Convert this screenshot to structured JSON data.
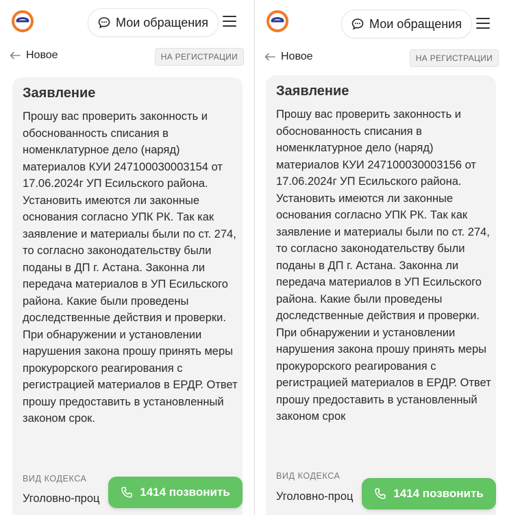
{
  "screens": [
    {
      "header": {
        "my_requests_label": "Мои обращения"
      },
      "subheader": {
        "back_label": "Новое",
        "status_badge": "НА РЕГИСТРАЦИИ"
      },
      "card": {
        "title": "Заявление",
        "body": "Прошу вас проверить законность и обоснованность списания в номенклатурное дело (наряд) материалов КУИ 247100030003154 от 17.06.2024г УП Есильского района. Установить имеются ли законные основания согласно УПК РК. Так как заявление и материалы были по ст. 274, то согласно законодательству были поданы в ДП г. Астана. Законна ли передача материалов в УП Есильского района. Какие были проведены доследственные действия и проверки. При обнаружении и установлении нарушения закона прошу принять меры прокурорского реагирования с регистрацией материалов в ЕРДР. Ответ прошу предоставить в установленный законом срок.",
        "code_type_label": "ВИД КОДЕКСА",
        "code_type_value": "Уголовно-проц"
      },
      "call_button_label": "1414 позвонить"
    },
    {
      "header": {
        "my_requests_label": "Мои обращения"
      },
      "subheader": {
        "back_label": "Новое",
        "status_badge": "НА РЕГИСТРАЦИИ"
      },
      "card": {
        "title": "Заявление",
        "body": "Прошу вас проверить законность и обоснованность списания в номенклатурное дело (наряд) материалов КУИ 247100030003156 от 17.06.2024г УП Есильского района. Установить имеются ли законные основания согласно УПК РК. Так как заявление и материалы были по ст. 274, то согласно законодательству были поданы в ДП г. Астана. Законна ли передача материалов в УП Есильского района. Какие были проведены доследственные действия и проверки. При обнаружении и установлении нарушения закона прошу принять меры прокурорского реагирования с регистрацией материалов в ЕРДР. Ответ прошу предоставить в установленный законом срок",
        "code_type_label": "ВИД КОДЕКСА",
        "code_type_value": "Уголовно-проц"
      },
      "call_button_label": "1414 позвонить"
    }
  ],
  "icons": {
    "logo": "e-otinish-logo-icon",
    "chat": "chat-bubble-icon",
    "menu": "hamburger-menu-icon",
    "back": "arrow-left-icon",
    "phone": "phone-icon"
  },
  "colors": {
    "accent_green": "#62c462",
    "logo_orange": "#f07a2a",
    "logo_blue": "#2f3a8f",
    "card_bg": "#f3f3f3",
    "badge_bg": "#f1f1f1"
  }
}
